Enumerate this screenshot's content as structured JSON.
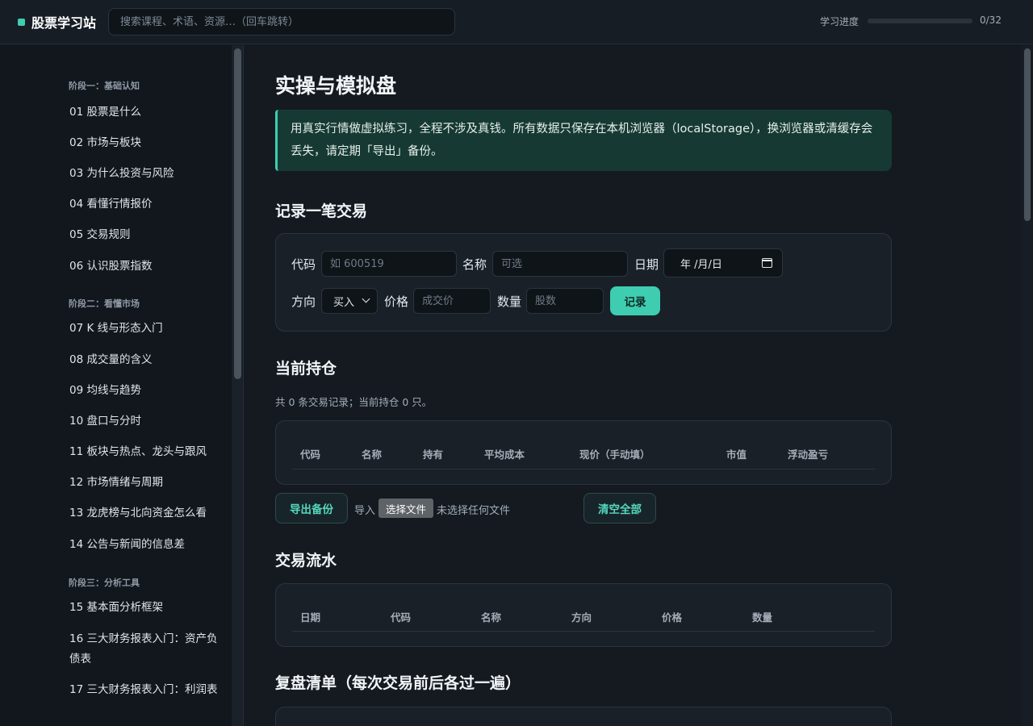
{
  "app": {
    "brand": "股票学习站"
  },
  "search": {
    "placeholder": "搜索课程、术语、资源…（回车跳转）"
  },
  "progress": {
    "label": "学习进度",
    "count": "0/32",
    "fraction": 0
  },
  "sidebar": {
    "stages": [
      "阶段一：基础认知",
      "阶段二：看懂市场",
      "阶段三：分析工具"
    ],
    "items": [
      "01 股票是什么",
      "02 市场与板块",
      "03 为什么投资与风险",
      "04 看懂行情报价",
      "05 交易规则",
      "06 认识股票指数",
      "07 K 线与形态入门",
      "08 成交量的含义",
      "09 均线与趋势",
      "10 盘口与分时",
      "11 板块与热点、龙头与跟风",
      "12 市场情绪与周期",
      "13 龙虎榜与北向资金怎么看",
      "14 公告与新闻的信息差",
      "15 基本面分析框架",
      "16 三大财务报表入门：资产负债表",
      "17 三大财务报表入门：利润表"
    ]
  },
  "main": {
    "title": "实操与模拟盘",
    "notice": "用真实行情做虚拟练习，全程不涉及真钱。所有数据只保存在本机浏览器（localStorage），换浏览器或清缓存会丢失，请定期「导出」备份。",
    "record": {
      "heading": "记录一笔交易",
      "code_label": "代码",
      "code_placeholder": "如 600519",
      "name_label": "名称",
      "name_placeholder": "可选",
      "date_label": "日期",
      "date_value": "年 /月/日",
      "side_label": "方向",
      "side_value": "买入",
      "price_label": "价格",
      "price_placeholder": "成交价",
      "qty_label": "数量",
      "qty_placeholder": "股数",
      "submit": "记录"
    },
    "holdings": {
      "heading": "当前持仓",
      "summary": "共 0 条交易记录；当前持仓 0 只。",
      "columns": [
        "代码",
        "名称",
        "持有",
        "平均成本",
        "现价（手动填）",
        "市值",
        "浮动盈亏"
      ],
      "export": "导出备份",
      "import_label": "导入",
      "file_button": "选择文件",
      "file_status": "未选择任何文件",
      "clear": "清空全部"
    },
    "ledger": {
      "heading": "交易流水",
      "columns": [
        "日期",
        "代码",
        "名称",
        "方向",
        "价格",
        "数量"
      ]
    },
    "checklist": {
      "heading": "复盘清单（每次交易前后各过一遍）"
    }
  },
  "colors": {
    "accent": "#3ecdb0",
    "background": "#141a20",
    "notice_bg": "#163a33"
  }
}
